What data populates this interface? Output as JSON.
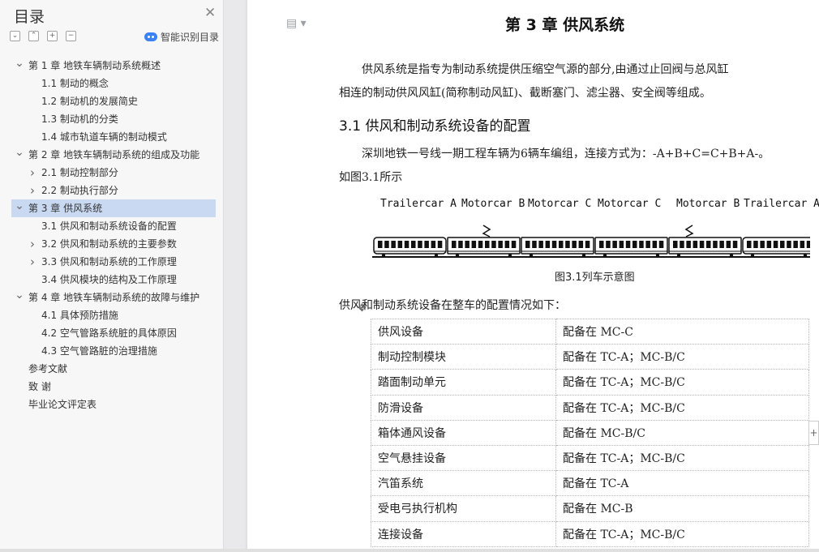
{
  "sidebar": {
    "title": "目录",
    "smart_label": "智能识别目录",
    "toc": [
      {
        "text": "第 1 章  地铁车辆制动系统概述",
        "level": 0,
        "chevron": "down"
      },
      {
        "text": "1.1 制动的概念",
        "level": 1,
        "chevron": ""
      },
      {
        "text": "1.2 制动机的发展简史",
        "level": 1,
        "chevron": ""
      },
      {
        "text": "1.3 制动机的分类",
        "level": 1,
        "chevron": ""
      },
      {
        "text": "1.4 城市轨道车辆的制动模式",
        "level": 1,
        "chevron": ""
      },
      {
        "text": "第 2 章  地铁车辆制动系统的组成及功能",
        "level": 0,
        "chevron": "down"
      },
      {
        "text": "2.1 制动控制部分",
        "level": 1,
        "chevron": "right"
      },
      {
        "text": "2.2 制动执行部分",
        "level": 1,
        "chevron": "right"
      },
      {
        "text": "第 3 章  供风系统",
        "level": 0,
        "chevron": "down",
        "active": true
      },
      {
        "text": "3.1 供风和制动系统设备的配置",
        "level": 1,
        "chevron": ""
      },
      {
        "text": "3.2 供风和制动系统的主要参数",
        "level": 1,
        "chevron": "right"
      },
      {
        "text": "3.3 供风和制动系统的工作原理",
        "level": 1,
        "chevron": "right"
      },
      {
        "text": "3.4 供风模块的结构及工作原理",
        "level": 1,
        "chevron": ""
      },
      {
        "text": "第 4 章  地铁车辆制动系统的故障与维护",
        "level": 0,
        "chevron": "down"
      },
      {
        "text": "4.1 具体预防措施",
        "level": 1,
        "chevron": ""
      },
      {
        "text": "4.2 空气管路系统脏的具体原因",
        "level": 1,
        "chevron": ""
      },
      {
        "text": "4.3 空气管路脏的治理措施",
        "level": 1,
        "chevron": ""
      },
      {
        "text": "参考文献",
        "level": -1,
        "chevron": ""
      },
      {
        "text": "致    谢",
        "level": -1,
        "chevron": ""
      },
      {
        "text": "毕业论文评定表",
        "level": -1,
        "chevron": ""
      }
    ]
  },
  "doc": {
    "chapter_title": "第 3 章  供风系统",
    "para1_line1": "供风系统是指专为制动系统提供压缩空气源的部分,由通过止回阀与总风缸",
    "para1_line2": "相连的制动供风风缸(简称制动风缸)、截断塞门、滤尘器、安全阀等组成。",
    "section_heading": "3.1 供风和制动系统设备的配置",
    "para2_line1": "深圳地铁一号线一期工程车辆为6辆车编组，连接方式为：-A+B+C=C+B+A-。",
    "para2_line2": "如图3.1所示",
    "train_labels": [
      "Trailercar A",
      "Motorcar B",
      "Motorcar C",
      "Motorcar C",
      "Motorcar B",
      "Trailercar A"
    ],
    "figure_caption": "图3.1列车示意图",
    "para3": "供风和制动系统设备在整车的配置情况如下：",
    "table": [
      [
        "供风设备",
        "配备在 MC-C"
      ],
      [
        "制动控制模块",
        "配备在 TC-A；MC-B/C"
      ],
      [
        "踏面制动单元",
        "配备在 TC-A；MC-B/C"
      ],
      [
        "防滑设备",
        "配备在 TC-A；MC-B/C"
      ],
      [
        "箱体通风设备",
        "配备在 MC-B/C"
      ],
      [
        "空气悬挂设备",
        "配备在 TC-A；MC-B/C"
      ],
      [
        "汽笛系统",
        "配备在 TC-A"
      ],
      [
        "受电弓执行机构",
        "配备在 MC-B"
      ],
      [
        "连接设备",
        "配备在 TC-A；MC-B/C"
      ]
    ]
  }
}
